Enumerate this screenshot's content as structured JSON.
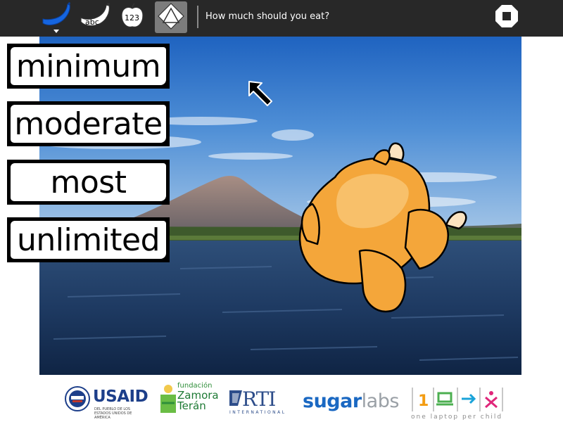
{
  "toolbar": {
    "title": "How much should you eat?",
    "active_tool": "shape-tool",
    "tools": [
      {
        "name": "banana-tool",
        "icon": "banana-icon",
        "color": "#1565e0"
      },
      {
        "name": "abc-tool",
        "icon": "banana-abc-icon",
        "label": "abc"
      },
      {
        "name": "numbers-tool",
        "icon": "apple-123-icon",
        "label": "123"
      },
      {
        "name": "shape-tool",
        "icon": "triangle-shape-icon"
      }
    ],
    "stop_icon": "stop-icon"
  },
  "scene": {
    "background": "volcano-lake-photo",
    "sprite": "roast-chicken"
  },
  "choices": [
    {
      "label": "minimum"
    },
    {
      "label": "moderate"
    },
    {
      "label": "most"
    },
    {
      "label": "unlimited"
    }
  ],
  "footer": {
    "usaid": {
      "name": "USAID",
      "sub": "DEL PUEBLO DE LOS ESTADOS UNIDOS DE AMÉRICA"
    },
    "zamora": {
      "prefix": "fundación",
      "line1": "Zamora",
      "line2": "Terán"
    },
    "rti": {
      "name": "RTI",
      "sub": "INTERNATIONAL"
    },
    "sugarlabs": {
      "part1": "sugar",
      "part2": "labs"
    },
    "olpc": {
      "tagline": "one laptop per child"
    }
  },
  "colors": {
    "toolbar_bg": "#282828",
    "active_tool_bg": "#7c7c7c",
    "chicken": "#f4a63a"
  }
}
